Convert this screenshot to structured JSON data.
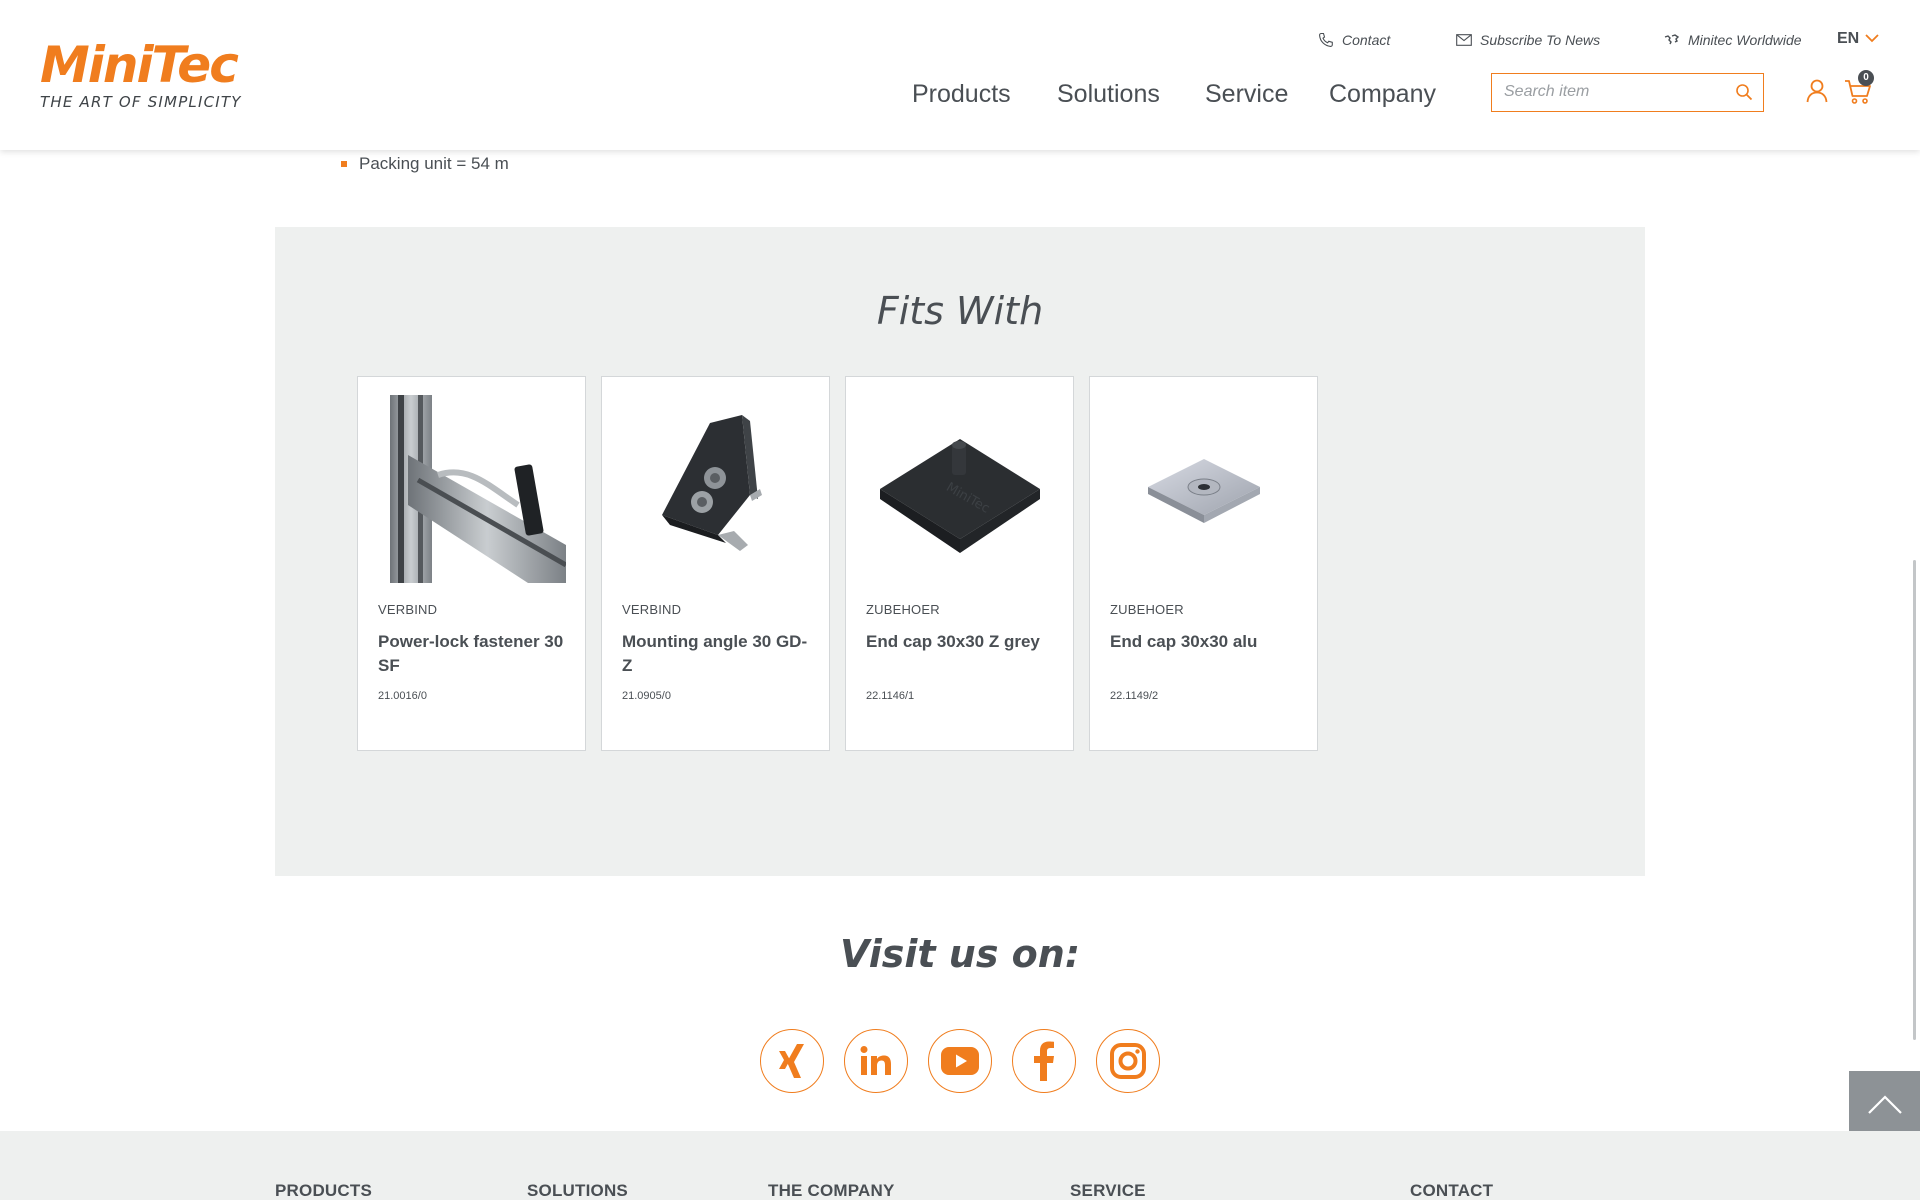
{
  "header": {
    "logo_word": "MiniTec",
    "logo_tagline": "THE ART OF SIMPLICITY",
    "utility": {
      "contact": "Contact",
      "subscribe": "Subscribe To News",
      "worldwide": "Minitec Worldwide",
      "language": "EN"
    },
    "nav": [
      "Products",
      "Solutions",
      "Service",
      "Company"
    ],
    "search_placeholder": "Search item",
    "cart_count": "0"
  },
  "details": {
    "packing": "Packing unit = 54 m"
  },
  "fits_with": {
    "title": "Fits With",
    "cards": [
      {
        "category": "VERBIND",
        "name": "Power-lock fastener 30 SF",
        "sku": "21.0016/0",
        "image": "power-lock-fastener-image"
      },
      {
        "category": "VERBIND",
        "name": "Mounting angle 30 GD-Z",
        "sku": "21.0905/0",
        "image": "mounting-angle-image"
      },
      {
        "category": "ZUBEHOER",
        "name": "End cap 30x30 Z grey",
        "sku": "22.1146/1",
        "image": "end-cap-grey-image"
      },
      {
        "category": "ZUBEHOER",
        "name": "End cap 30x30 alu",
        "sku": "22.1149/2",
        "image": "end-cap-alu-image"
      }
    ]
  },
  "social": {
    "title": "Visit us on:",
    "icons": [
      "xing-icon",
      "linkedin-icon",
      "youtube-icon",
      "facebook-icon",
      "instagram-icon"
    ]
  },
  "footer": {
    "headings": [
      "PRODUCTS",
      "SOLUTIONS",
      "THE COMPANY",
      "SERVICE",
      "CONTACT"
    ]
  },
  "colors": {
    "brand_orange": "#f07d1e",
    "text_dark": "#4a4f54",
    "panel_grey": "#eef0ef"
  }
}
